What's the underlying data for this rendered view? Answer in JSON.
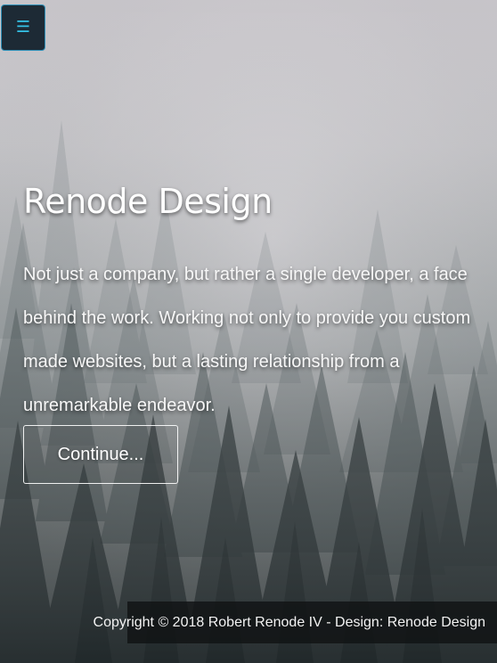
{
  "menu": {
    "icon": "hamburger-menu-icon",
    "glyph": "☰"
  },
  "hero": {
    "title": "Renode Design",
    "description": "Not just a company, but rather a single developer, a face behind the work. Working not only to provide you custom made websites, but a lasting relationship from a unremarkable endeavor.",
    "button_label": "Continue..."
  },
  "footer": {
    "copyright": "Copyright © 2018 Robert Renode IV - Design: Renode Design"
  },
  "colors": {
    "menu_background": "#1d2a35",
    "menu_border": "#2f90b8",
    "menu_icon": "#35c3e8",
    "text": "#ffffff",
    "footer_background": "#101213"
  }
}
